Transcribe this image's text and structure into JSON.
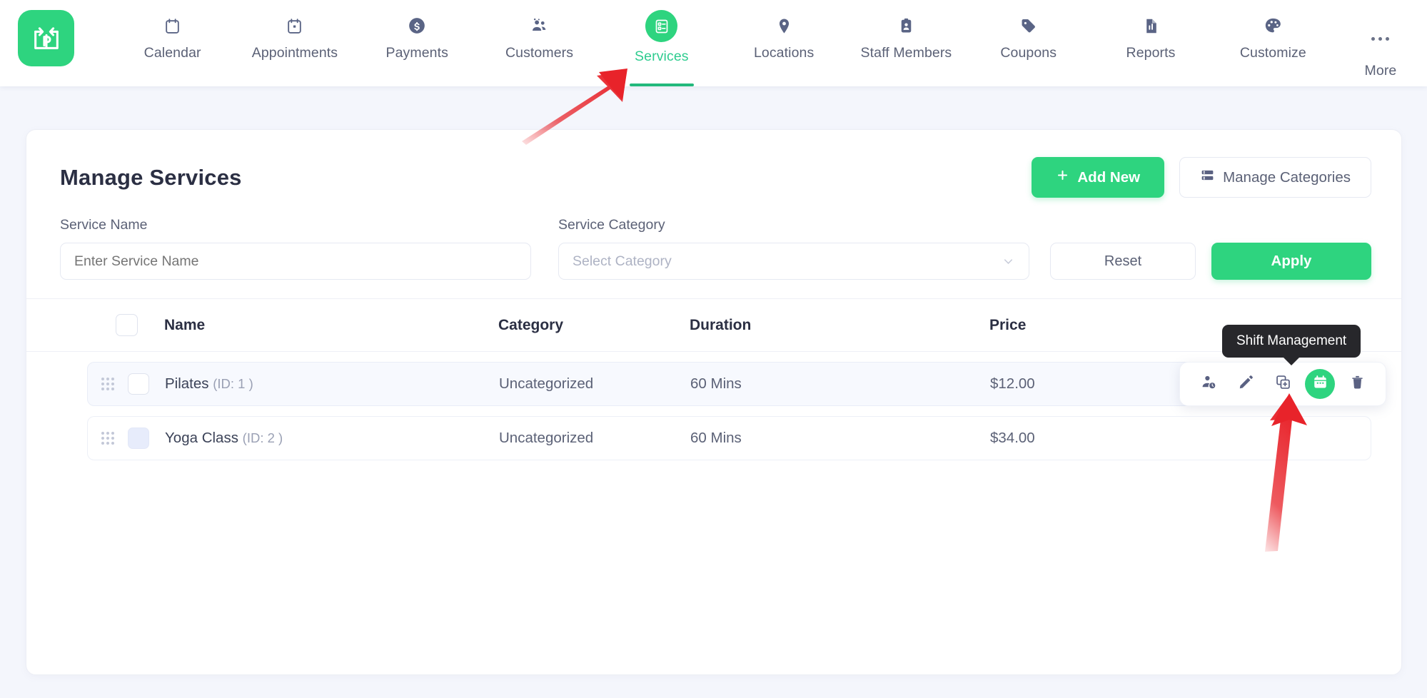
{
  "app": {
    "logo_icon": "booking-logo-icon",
    "accent_color": "#2ed47f",
    "page_bg": "#f4f6fc"
  },
  "nav": {
    "items": [
      {
        "label": "Calendar",
        "icon": "calendar-icon",
        "active": false
      },
      {
        "label": "Appointments",
        "icon": "appointments-icon",
        "active": false
      },
      {
        "label": "Payments",
        "icon": "dollar-icon",
        "active": false
      },
      {
        "label": "Customers",
        "icon": "customers-icon",
        "active": false
      },
      {
        "label": "Services",
        "icon": "services-icon",
        "active": true
      },
      {
        "label": "Locations",
        "icon": "location-pin-icon",
        "active": false
      },
      {
        "label": "Staff Members",
        "icon": "badge-icon",
        "active": false
      },
      {
        "label": "Coupons",
        "icon": "tag-icon",
        "active": false
      },
      {
        "label": "Reports",
        "icon": "report-icon",
        "active": false
      },
      {
        "label": "Customize",
        "icon": "palette-icon",
        "active": false
      }
    ],
    "more": {
      "label": "More",
      "icon": "ellipsis-icon"
    }
  },
  "header": {
    "title": "Manage Services",
    "add_new_label": "Add New",
    "add_new_icon": "plus-icon",
    "manage_categories_label": "Manage Categories",
    "manage_categories_icon": "list-settings-icon"
  },
  "filters": {
    "service_name_label": "Service Name",
    "service_name_placeholder": "Enter Service Name",
    "service_name_value": "",
    "service_category_label": "Service Category",
    "service_category_value": "Select Category",
    "category_chevron_icon": "chevron-down-icon",
    "reset_label": "Reset",
    "apply_label": "Apply"
  },
  "table": {
    "columns": [
      "Name",
      "Category",
      "Duration",
      "Price"
    ],
    "header_checkbox_checked": false,
    "rows": [
      {
        "drag_icon": "drag-handle-icon",
        "checked": false,
        "checkbox_state": "empty",
        "name": "Pilates",
        "id_text": "(ID: 1 )",
        "category": "Uncategorized",
        "duration": "60 Mins",
        "price": "$12.00",
        "hovered": true
      },
      {
        "drag_icon": "drag-handle-icon",
        "checked": false,
        "checkbox_state": "filled",
        "name": "Yoga Class",
        "id_text": "(ID: 2 )",
        "category": "Uncategorized",
        "duration": "60 Mins",
        "price": "$34.00",
        "hovered": false
      }
    ]
  },
  "row_actions": {
    "items": [
      {
        "icon": "assign-staff-icon",
        "name": "assign-staff-action",
        "highlighted": false
      },
      {
        "icon": "pencil-icon",
        "name": "edit-action",
        "highlighted": false
      },
      {
        "icon": "duplicate-icon",
        "name": "duplicate-action",
        "highlighted": false
      },
      {
        "icon": "calendar-shift-icon",
        "name": "shift-management-action",
        "highlighted": true
      },
      {
        "icon": "trash-icon",
        "name": "delete-action",
        "highlighted": false
      }
    ]
  },
  "tooltip": {
    "text": "Shift Management"
  },
  "annotations": {
    "arrow_color": "#e8232a",
    "arrows": [
      {
        "name": "arrow-to-services-tab",
        "points_at": "Services"
      },
      {
        "name": "arrow-to-shift-management",
        "points_at": "Shift Management"
      }
    ]
  }
}
